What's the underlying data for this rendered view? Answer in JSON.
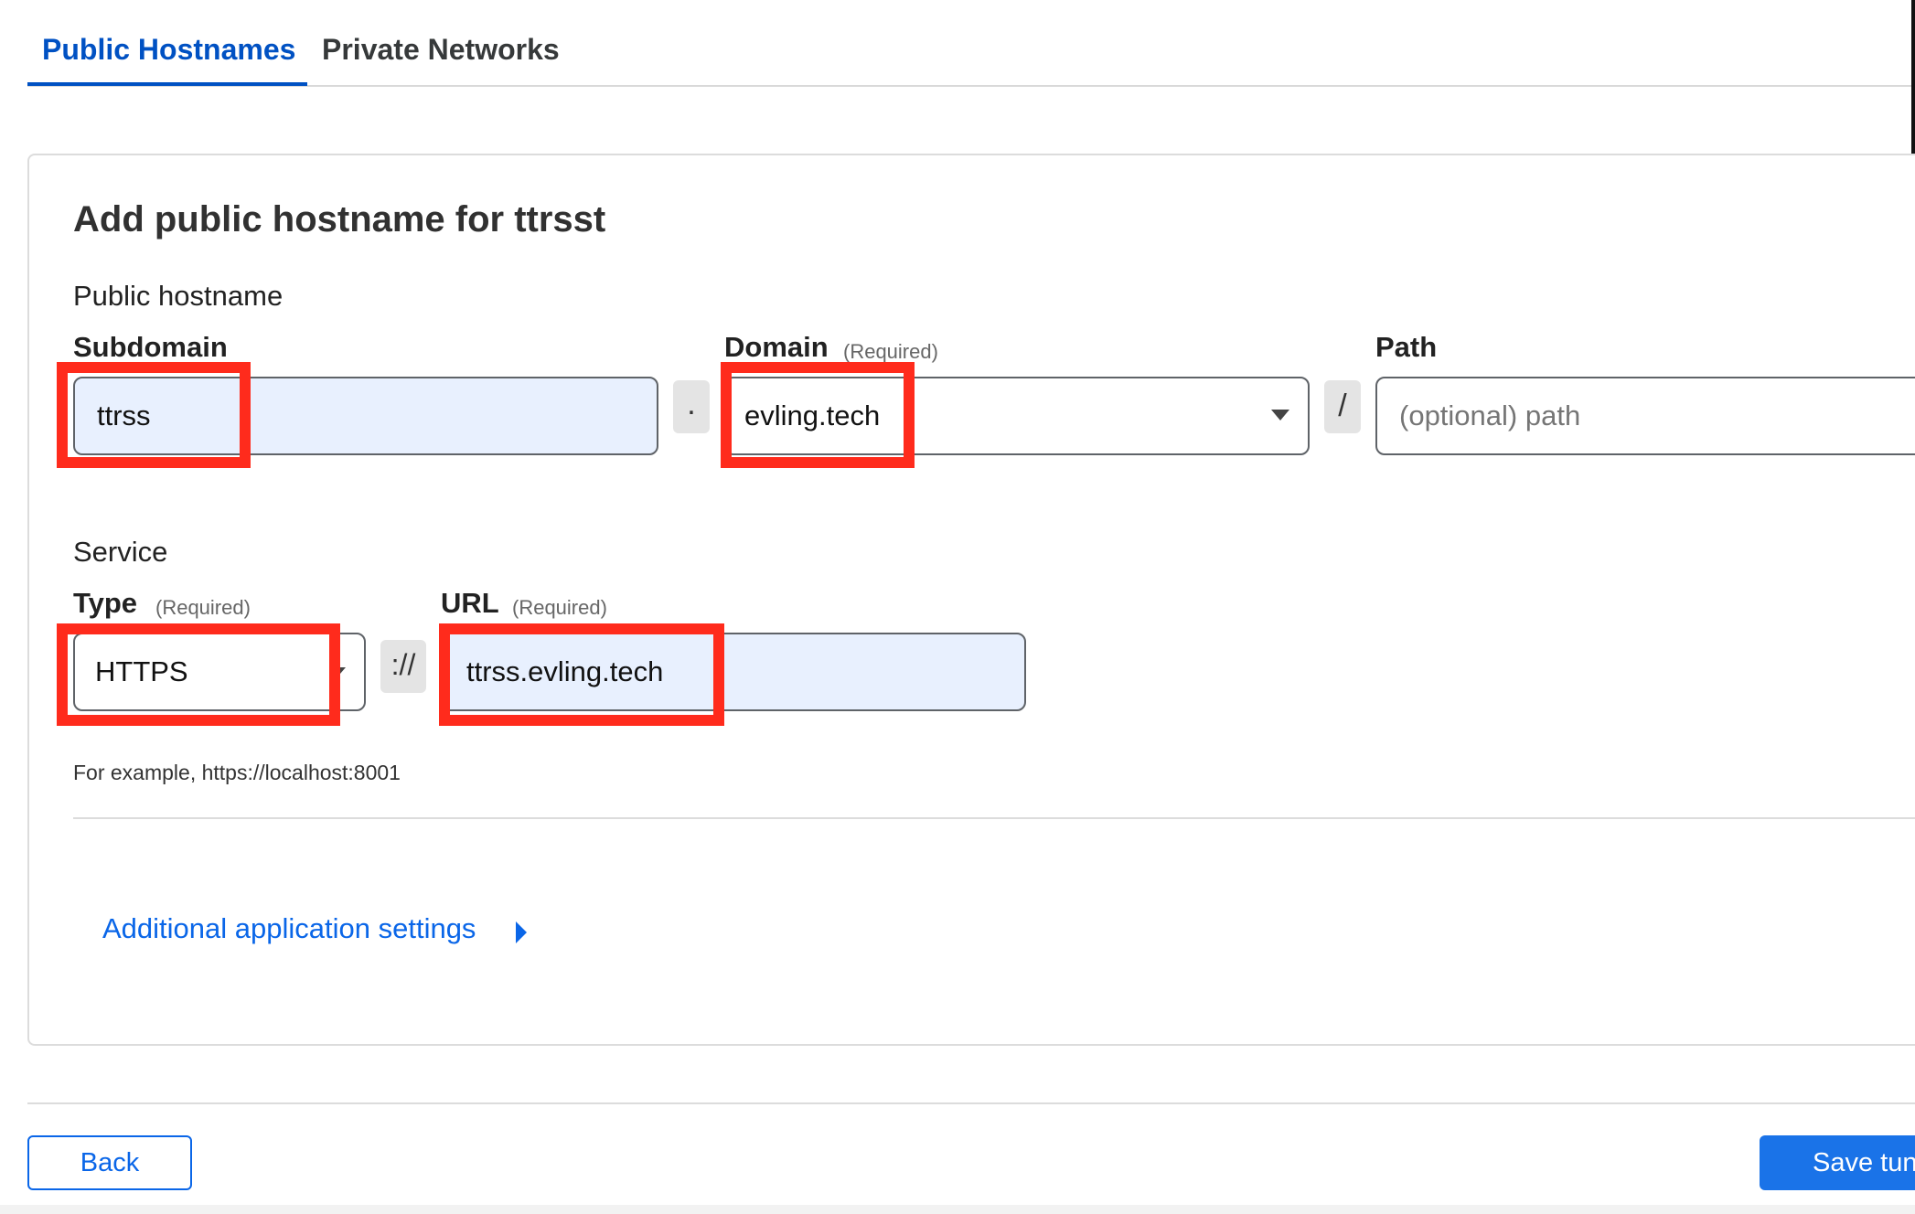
{
  "tabs": [
    {
      "label": "Public Hostnames",
      "active": true
    },
    {
      "label": "Private Networks",
      "active": false
    }
  ],
  "form": {
    "title": "Add public hostname for ttrsst",
    "public_hostname": {
      "section_label": "Public hostname",
      "subdomain": {
        "label": "Subdomain",
        "value": "ttrss"
      },
      "dot_separator": ".",
      "domain": {
        "label": "Domain",
        "required": "(Required)",
        "value": "evling.tech"
      },
      "slash_separator": "/",
      "path": {
        "label": "Path",
        "placeholder": "(optional) path"
      }
    },
    "service": {
      "section_label": "Service",
      "type": {
        "label": "Type",
        "required": "(Required)",
        "value": "HTTPS"
      },
      "scheme_separator": "://",
      "url": {
        "label": "URL",
        "required": "(Required)",
        "value": "ttrss.evling.tech"
      },
      "hint": "For example, https://localhost:8001"
    },
    "additional_settings_link": "Additional application settings"
  },
  "footer": {
    "back_label": "Back",
    "save_label": "Save tunnel"
  },
  "colors": {
    "accent": "#0051c3",
    "link": "#0a66e8",
    "highlight": "#ff2b1c",
    "input_filled_bg": "#e8f0fe"
  }
}
